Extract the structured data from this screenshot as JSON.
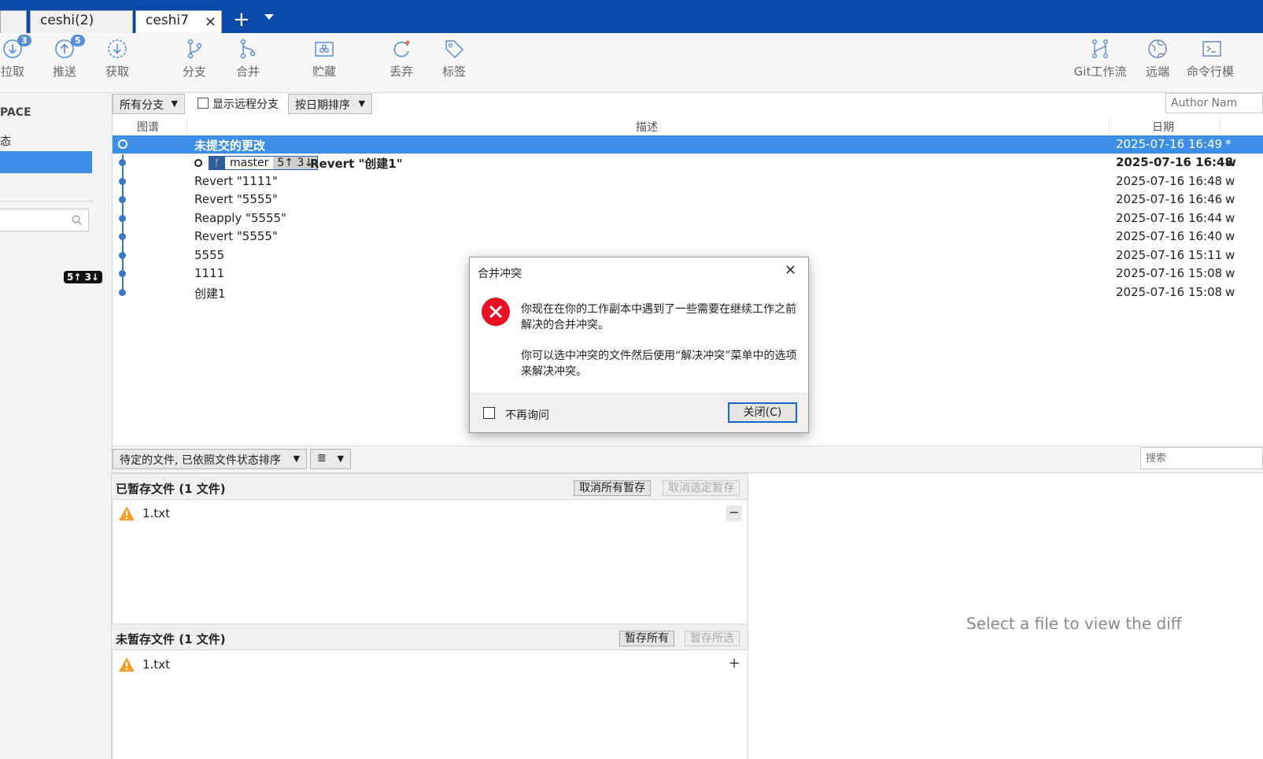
{
  "tabs": [
    {
      "label": "ceshi(2)",
      "active": false
    },
    {
      "label": "ceshi7",
      "active": true
    }
  ],
  "toolbar": {
    "buttons": [
      {
        "label": "拉取",
        "icon": "pull-icon",
        "badge": "3"
      },
      {
        "label": "推送",
        "icon": "push-icon",
        "badge": "5"
      },
      {
        "label": "获取",
        "icon": "fetch-icon"
      },
      {
        "label": "分支",
        "icon": "branch-icon"
      },
      {
        "label": "合并",
        "icon": "merge-icon"
      },
      {
        "label": "贮藏",
        "icon": "stash-icon"
      },
      {
        "label": "丢弃",
        "icon": "discard-icon"
      },
      {
        "label": "标签",
        "icon": "tag-icon"
      },
      {
        "label": "Git工作流",
        "icon": "git-flow-icon"
      },
      {
        "label": "远端",
        "icon": "remote-icon"
      },
      {
        "label": "命令行模",
        "icon": "terminal-icon"
      }
    ]
  },
  "sidebar": {
    "workspace_label": "PACE",
    "status_label": "态",
    "search_placeholder": "",
    "sync_badge": "5↑ 3↓"
  },
  "filters": {
    "branch_select": "所有分支",
    "show_remote_label": "显示远程分支",
    "sort_select": "按日期排序",
    "author_placeholder": "Author Nam"
  },
  "columns": {
    "graph": "图谱",
    "description": "描述",
    "date": "日期"
  },
  "commits": [
    {
      "description": "未提交的更改",
      "date": "2025-07-16 16:49",
      "author": "*",
      "selected": true
    },
    {
      "description": "Revert \"创建1\"",
      "date": "2025-07-16 16:48",
      "author": "w",
      "branch": "master",
      "sync": "5↑ 3↓",
      "bold": true
    },
    {
      "description": "Revert \"1111\"",
      "date": "2025-07-16 16:48",
      "author": "w"
    },
    {
      "description": "Revert \"5555\"",
      "date": "2025-07-16 16:46",
      "author": "w"
    },
    {
      "description": "Reapply \"5555\"",
      "date": "2025-07-16 16:44",
      "author": "w"
    },
    {
      "description": "Revert \"5555\"",
      "date": "2025-07-16 16:40",
      "author": "w"
    },
    {
      "description": "5555",
      "date": "2025-07-16 15:11",
      "author": "w"
    },
    {
      "description": "1111",
      "date": "2025-07-16 15:08",
      "author": "w"
    },
    {
      "description": "创建1",
      "date": "2025-07-16 15:08",
      "author": "w"
    }
  ],
  "files_bar": {
    "sort_select": "待定的文件, 已依照文件状态排序",
    "view_select": "≣",
    "search_placeholder": "搜索"
  },
  "staged": {
    "title": "已暂存文件 (1 文件)",
    "unstage_all": "取消所有暂存",
    "unstage_selected": "取消选定暂存",
    "files": [
      "1.txt"
    ]
  },
  "unstaged": {
    "title": "未暂存文件 (1 文件)",
    "stage_all": "暂存所有",
    "stage_selected": "暂存所选",
    "files": [
      "1.txt"
    ]
  },
  "diff_placeholder": "Select a file to view the diff",
  "dialog": {
    "title": "合并冲突",
    "message1": "你现在在你的工作副本中遇到了一些需要在继续工作之前解决的合并冲突。",
    "message2": "你可以选中冲突的文件然后使用“解决冲突”菜单中的选项来解决冲突。",
    "dont_ask": "不再询问",
    "close_button": "关闭(C)"
  },
  "colors": {
    "accent": "#0b4aa8",
    "selection": "#3d8fe6",
    "graph": "#3a78c3",
    "error": "#e81123",
    "warning": "#f0a030"
  }
}
